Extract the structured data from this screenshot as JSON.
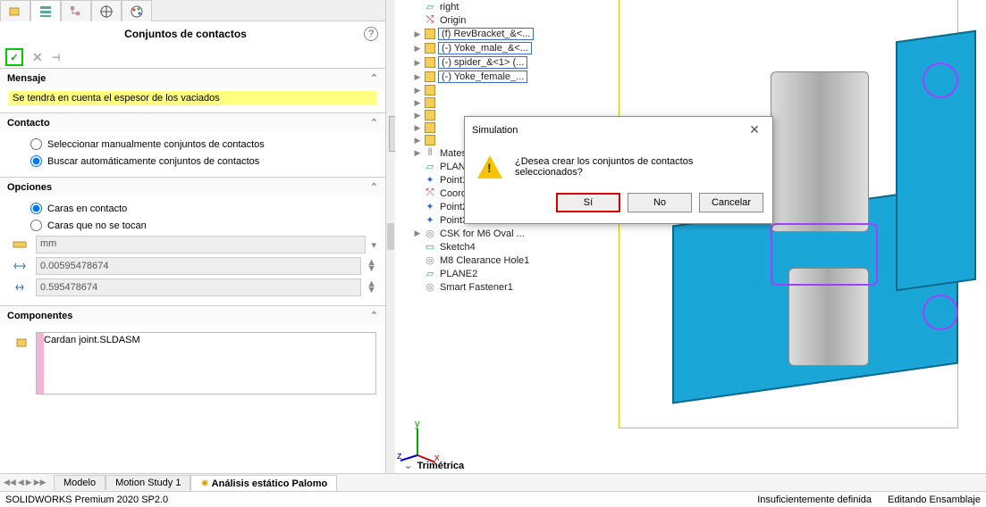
{
  "panel": {
    "title": "Conjuntos de contactos",
    "ok": "✓",
    "cancel": "✕",
    "pin": "⊣"
  },
  "mensaje": {
    "header": "Mensaje",
    "text": "Se tendrá en cuenta el espesor de los vaciados"
  },
  "contacto": {
    "header": "Contacto",
    "opt_manual": "Seleccionar manualmente conjuntos de contactos",
    "opt_auto": "Buscar automáticamente conjuntos de contactos",
    "selected": "auto"
  },
  "opciones": {
    "header": "Opciones",
    "opt_touch": "Caras en contacto",
    "opt_notouch": "Caras que no se tocan",
    "selected": "touch",
    "unit": "mm",
    "val1": "0.00595478674",
    "val2": "0.595478674"
  },
  "componentes": {
    "header": "Componentes",
    "items": [
      "Cardan joint.SLDASM"
    ]
  },
  "tree": [
    {
      "exp": "",
      "ico": "plane",
      "label": "right",
      "boxed": false,
      "indent": 1
    },
    {
      "exp": "",
      "ico": "origin",
      "label": "Origin",
      "boxed": false,
      "indent": 1
    },
    {
      "exp": "▶",
      "ico": "part",
      "label": "(f) RevBracket_&<...",
      "boxed": true,
      "indent": 1
    },
    {
      "exp": "▶",
      "ico": "part",
      "label": "(-) Yoke_male_&<...",
      "boxed": true,
      "indent": 1
    },
    {
      "exp": "▶",
      "ico": "part",
      "label": "(-) spider_&<1> (...",
      "boxed": true,
      "indent": 1
    },
    {
      "exp": "▶",
      "ico": "part",
      "label": "(-) Yoke_female_...",
      "boxed": true,
      "indent": 1
    },
    {
      "exp": "▶",
      "ico": "part",
      "label": "",
      "boxed": false,
      "indent": 1
    },
    {
      "exp": "▶",
      "ico": "part",
      "label": "",
      "boxed": false,
      "indent": 1
    },
    {
      "exp": "▶",
      "ico": "part",
      "label": "",
      "boxed": false,
      "indent": 1
    },
    {
      "exp": "▶",
      "ico": "part",
      "label": "",
      "boxed": false,
      "indent": 1
    },
    {
      "exp": "▶",
      "ico": "part",
      "label": "",
      "boxed": false,
      "indent": 1
    },
    {
      "exp": "▶",
      "ico": "mates",
      "label": "Mates",
      "boxed": false,
      "indent": 1
    },
    {
      "exp": "",
      "ico": "plane",
      "label": "PLANE1",
      "boxed": false,
      "indent": 1
    },
    {
      "exp": "",
      "ico": "point",
      "label": "Point1",
      "boxed": false,
      "indent": 1
    },
    {
      "exp": "",
      "ico": "csys",
      "label": "Coordinate System1",
      "boxed": false,
      "indent": 1
    },
    {
      "exp": "",
      "ico": "point",
      "label": "Point2",
      "boxed": false,
      "indent": 1
    },
    {
      "exp": "",
      "ico": "point",
      "label": "Point3",
      "boxed": false,
      "indent": 1
    },
    {
      "exp": "▶",
      "ico": "feat",
      "label": "CSK for M6 Oval ...",
      "boxed": false,
      "indent": 1
    },
    {
      "exp": "",
      "ico": "sketch",
      "label": "Sketch4",
      "boxed": false,
      "indent": 1
    },
    {
      "exp": "",
      "ico": "feat",
      "label": "M8 Clearance Hole1",
      "boxed": false,
      "indent": 1
    },
    {
      "exp": "",
      "ico": "plane",
      "label": "PLANE2",
      "boxed": false,
      "indent": 1
    },
    {
      "exp": "",
      "ico": "feat",
      "label": "Smart Fastener1",
      "boxed": false,
      "indent": 1
    }
  ],
  "view_label": "Trimétrica",
  "dialog": {
    "title": "Simulation",
    "message": "¿Desea crear los conjuntos de contactos seleccionados?",
    "yes": "Sí",
    "no": "No",
    "cancel": "Cancelar"
  },
  "bottom_tabs": {
    "modelo": "Modelo",
    "motion": "Motion Study 1",
    "analysis": "Análisis estático Palomo"
  },
  "status": {
    "left": "SOLIDWORKS Premium 2020 SP2.0",
    "mid": "Insuficientemente definida",
    "right": "Editando Ensamblaje"
  }
}
